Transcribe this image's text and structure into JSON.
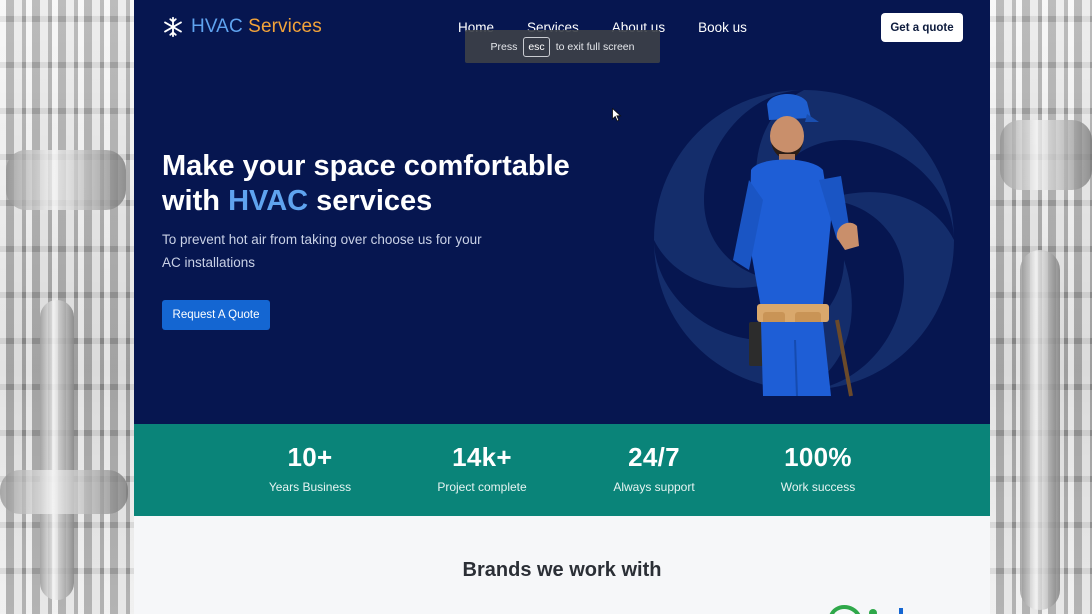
{
  "brand": {
    "name_main": "HVAC",
    "name_accent": "Services",
    "icon": "snowflake-icon"
  },
  "nav": {
    "links": [
      "Home",
      "Services",
      "About us",
      "Book us"
    ],
    "cta_label": "Get a quote"
  },
  "fullscreen_toast": {
    "prefix": "Press",
    "key": "esc",
    "suffix": "to exit full screen"
  },
  "hero": {
    "headline_line1": "Make your space comfortable",
    "headline_prefix": "with",
    "headline_highlight": "HVAC",
    "headline_suffix": "services",
    "subtext": "To prevent hot air from taking over choose us for your AC installations",
    "button_label": "Request A Quote"
  },
  "stats": [
    {
      "value": "10+",
      "label": "Years Business"
    },
    {
      "value": "14k+",
      "label": "Project complete"
    },
    {
      "value": "24/7",
      "label": "Always support"
    },
    {
      "value": "100%",
      "label": "Work success"
    }
  ],
  "brands": {
    "title": "Brands we work with"
  },
  "colors": {
    "hero_bg": "#061650",
    "accent_blue": "#5fa3ef",
    "accent_orange": "#f2a33a",
    "button_blue": "#1466d2",
    "stats_bg": "#0a8479"
  }
}
